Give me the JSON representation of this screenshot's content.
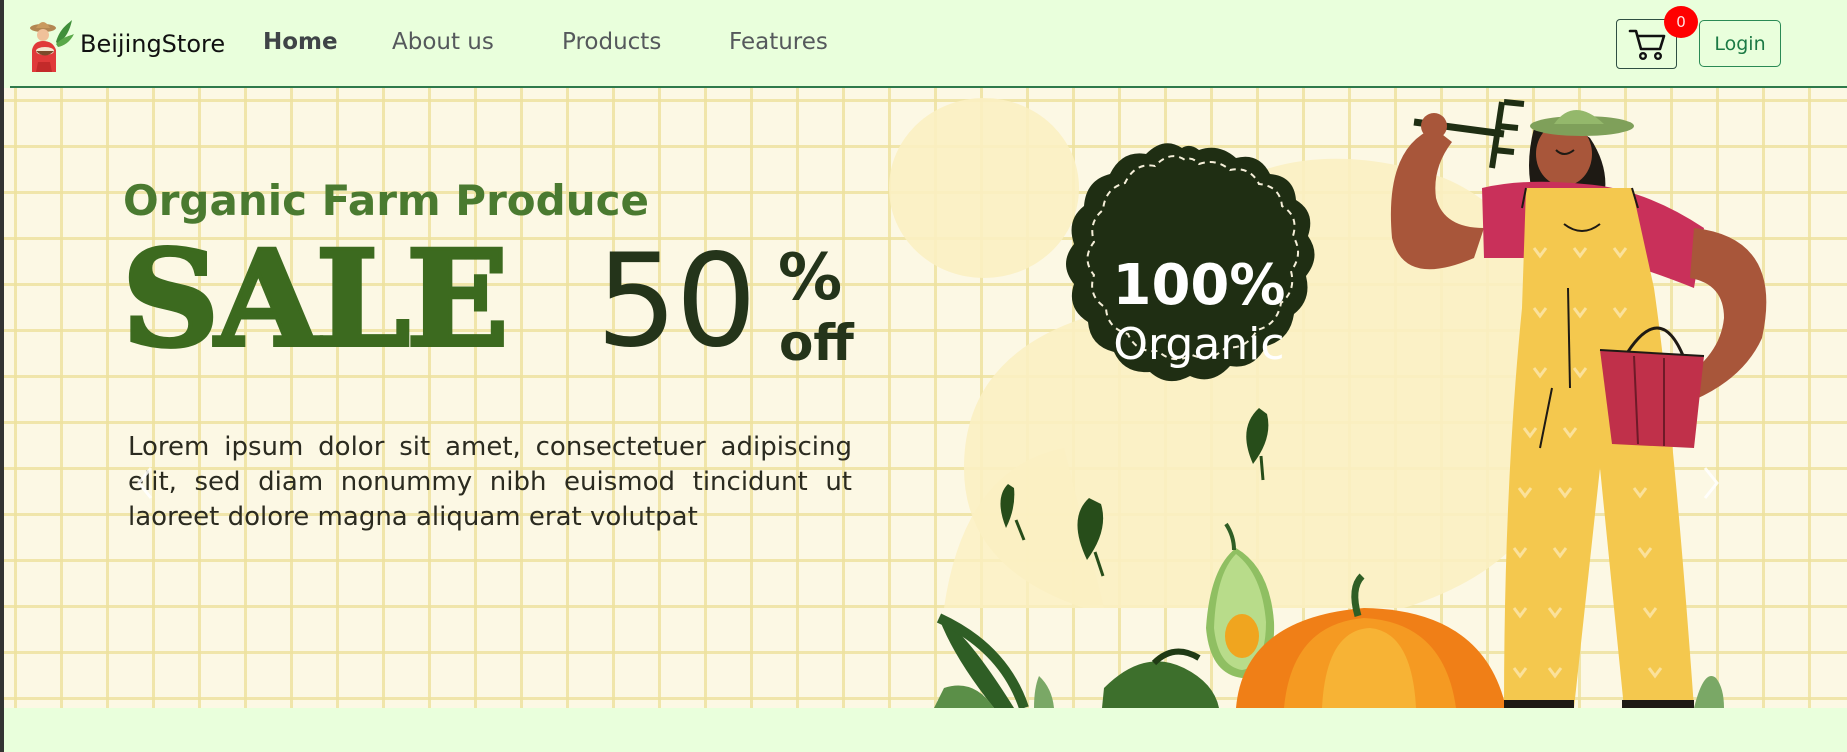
{
  "brand": {
    "name": "BeijingStore",
    "logo_icon": "farmer-logo-icon"
  },
  "nav": {
    "links": [
      {
        "label": "Home",
        "active": true
      },
      {
        "label": "About us",
        "active": false
      },
      {
        "label": "Products",
        "active": false
      },
      {
        "label": "Features",
        "active": false
      }
    ]
  },
  "cart": {
    "icon": "cart-icon",
    "count": "0"
  },
  "login": {
    "label": "Login"
  },
  "hero": {
    "subtitle": "Organic Farm Produce",
    "sale_word": "SALE",
    "discount_number": "50",
    "discount_percent": "%",
    "discount_off": "off",
    "description": "Lorem ipsum dolor sit amet, consectetuer adipiscing elit, sed diam nonummy nibh euismod tincidunt ut laoreet dolore magna aliquam erat volutpat",
    "badge_line1": "100%",
    "badge_line2": "Organic"
  },
  "carousel": {
    "prev_icon": "chevron-left-icon",
    "next_icon": "chevron-right-icon"
  },
  "colors": {
    "navbar_bg": "#e9ffdc",
    "accent_green": "#2a8a55",
    "dark_green": "#24341a",
    "sale_green": "#3c6a1f",
    "badge_red": "#ff0000",
    "hero_bg": "#fcf8e4"
  }
}
